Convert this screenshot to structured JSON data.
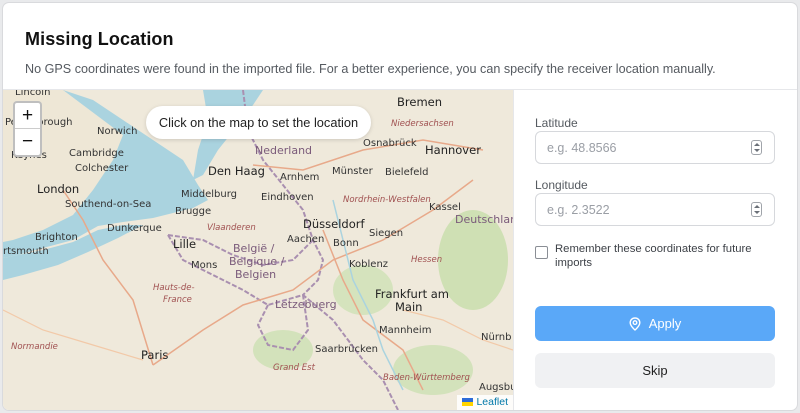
{
  "dialog": {
    "title": "Missing Location",
    "subtitle": "No GPS coordinates were found in the imported file. For a better experience, you can specify the receiver location manually."
  },
  "map": {
    "zoom_in": "+",
    "zoom_out": "−",
    "hint": "Click on the map to set the location",
    "attribution": "Leaflet",
    "places": [
      "Lincoln",
      "Bremen",
      "Norwich",
      "Peterborough",
      "Nederland",
      "Osnabrück",
      "Hannover",
      "Niedersachsen",
      "Cambridge",
      "Keynes",
      "Colchester",
      "Den Haag",
      "Arnhem",
      "Münster",
      "Bielefeld",
      "London",
      "Middelburg",
      "Eindhoven",
      "Southend-on-Sea",
      "Nordrhein-Westfalen",
      "Brugge",
      "Düsseldorf",
      "Kassel",
      "Deutschland",
      "Brighton",
      "Dunkerque",
      "Vlaanderen",
      "Siegen",
      "Lille",
      "Aachen",
      "Bonn",
      "rtsmouth",
      "België / Belgique / Belgien",
      "Mons",
      "Koblenz",
      "Hessen",
      "Hauts-de-France",
      "Letzebuerg",
      "Frankfurt am Main",
      "Mannheim",
      "Normandie",
      "Paris",
      "Saarbrücken",
      "Nürnb",
      "Grand Est",
      "Baden-Württemberg",
      "Augsbu"
    ],
    "colors": {
      "land": "#efe9db",
      "sea": "#aad3df",
      "forest": "#cfe0b4",
      "border": "#a98fb0"
    }
  },
  "form": {
    "latitude_label": "Latitude",
    "latitude_placeholder": "e.g. 48.8566",
    "latitude_value": "",
    "longitude_label": "Longitude",
    "longitude_placeholder": "e.g. 2.3522",
    "longitude_value": "",
    "remember_label": "Remember these coordinates for future imports",
    "remember_checked": false,
    "apply_label": "Apply",
    "skip_label": "Skip",
    "apply_icon": "map-pin-icon",
    "accent": "#5aa8f8"
  }
}
